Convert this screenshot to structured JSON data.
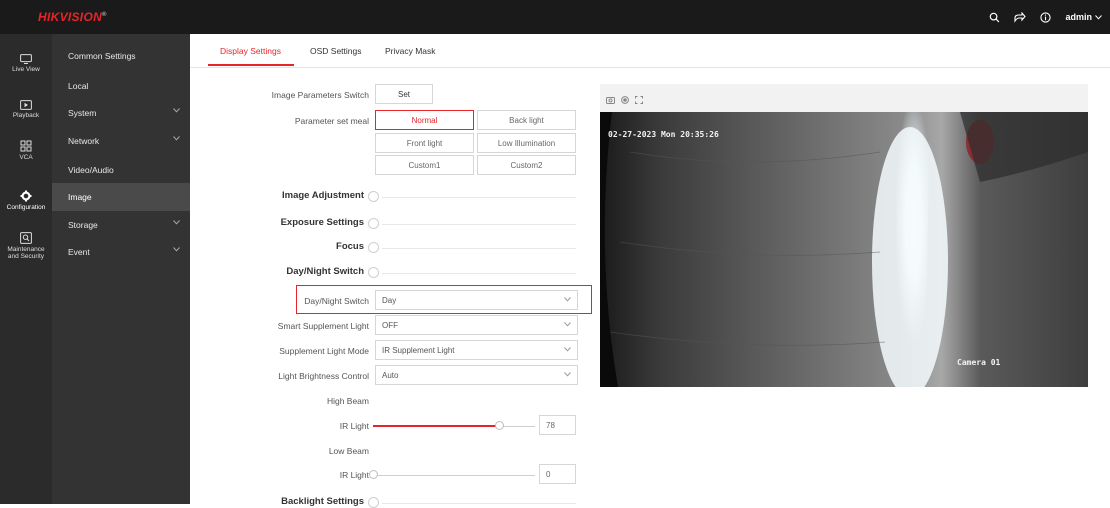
{
  "header": {
    "brand": "HIKVISION",
    "brand_mark": "®",
    "user": "admin"
  },
  "rail": {
    "items": [
      {
        "label": "Live View"
      },
      {
        "label": "Playback"
      },
      {
        "label": "VCA"
      },
      {
        "label": "Configuration"
      },
      {
        "label_line1": "Maintenance",
        "label_line2": "and Security"
      }
    ]
  },
  "subnav": {
    "items": [
      {
        "label": "Common Settings"
      },
      {
        "label": "Local"
      },
      {
        "label": "System"
      },
      {
        "label": "Network"
      },
      {
        "label": "Video/Audio"
      },
      {
        "label": "Image"
      },
      {
        "label": "Storage"
      },
      {
        "label": "Event"
      }
    ]
  },
  "tabs": [
    {
      "label": "Display Settings"
    },
    {
      "label": "OSD Settings"
    },
    {
      "label": "Privacy Mask"
    }
  ],
  "form": {
    "image_params_switch_label": "Image Parameters Switch",
    "set_label": "Set",
    "parameter_set_meal_label": "Parameter set meal",
    "meal_options": [
      "Normal",
      "Back light",
      "Front light",
      "Low Illumination",
      "Custom1",
      "Custom2"
    ],
    "sections": {
      "image_adjustment": "Image Adjustment",
      "exposure_settings": "Exposure Settings",
      "focus": "Focus",
      "day_night_switch": "Day/Night Switch",
      "backlight_settings": "Backlight Settings"
    },
    "day_night_switch_label": "Day/Night Switch",
    "day_night_switch_value": "Day",
    "smart_supplement_light_label": "Smart Supplement Light",
    "smart_supplement_light_value": "OFF",
    "supplement_light_mode_label": "Supplement Light Mode",
    "supplement_light_mode_value": "IR Supplement Light",
    "light_brightness_control_label": "Light Brightness Control",
    "light_brightness_control_value": "Auto",
    "high_beam_label": "High Beam",
    "high_beam_ir_label": "IR Light",
    "high_beam_ir_value": "78",
    "low_beam_label": "Low Beam",
    "low_beam_ir_label": "IR Light",
    "low_beam_ir_value": "0"
  },
  "preview": {
    "timestamp": "02-27-2023 Mon 20:35:26",
    "camera_name": "Camera 01"
  },
  "colors": {
    "accent": "#e6252a",
    "topbar": "#1a1a1a",
    "rail": "#2b2b2b",
    "subnav": "#333333"
  }
}
